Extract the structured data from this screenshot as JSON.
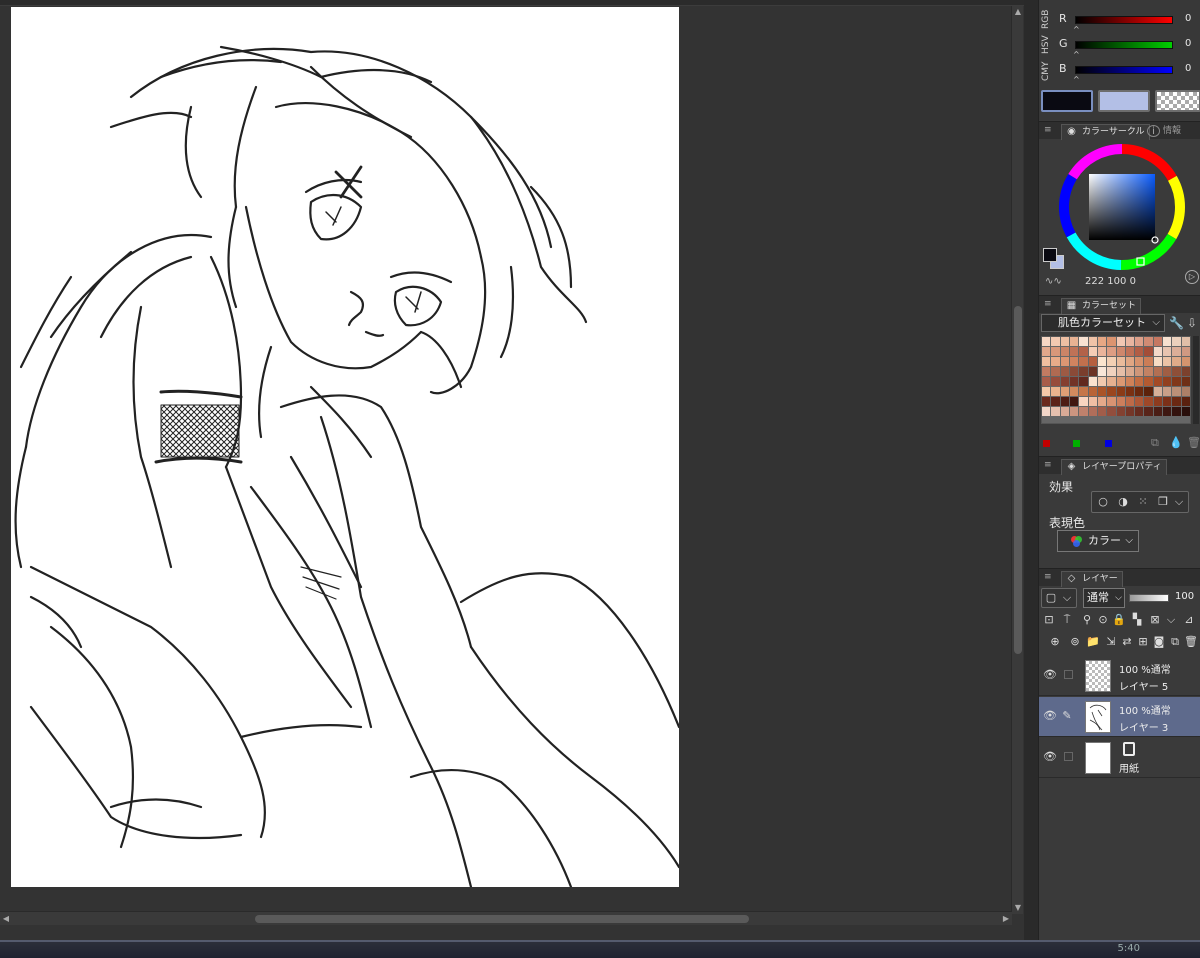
{
  "color_sliders": {
    "mode_tabs": [
      "RGB",
      "HSV",
      "CMY"
    ],
    "rows": [
      {
        "label": "R",
        "value": "0",
        "gradient": [
          "#000000",
          "#ff0000"
        ]
      },
      {
        "label": "G",
        "value": "0",
        "gradient": [
          "#000000",
          "#00d000"
        ]
      },
      {
        "label": "B",
        "value": "0",
        "gradient": [
          "#000000",
          "#0000ff"
        ]
      }
    ]
  },
  "colors": {
    "main": "#0a0a12",
    "sub": "#b3bfe6",
    "panel": "#3a3a3a",
    "selected_layer": "#5e6a8c"
  },
  "color_circle": {
    "tab": "カラーサークル",
    "tab2": "情報",
    "h_value": "222",
    "s_value": "100",
    "v_value": "0"
  },
  "color_set": {
    "tab": "カラーセット",
    "selected": "肌色カラーセット",
    "palette": [
      "#f7d7c4",
      "#f3c9b1",
      "#eebfa3",
      "#e8b293",
      "#f9e2d2",
      "#f0c3a8",
      "#e7a784",
      "#dc9470",
      "#f2c7b3",
      "#e9b5a0",
      "#dea08a",
      "#d18b74",
      "#c67862",
      "#f7e1d0",
      "#ecd1bd",
      "#e1bfa8",
      "#e2a88c",
      "#d8977a",
      "#cb8467",
      "#be7257",
      "#b26249",
      "#f5cdb5",
      "#eab49b",
      "#dd9d83",
      "#cf876c",
      "#c07157",
      "#b15d45",
      "#a34d38",
      "#f4d9c9",
      "#e8c4b0",
      "#dcae98",
      "#d09982",
      "#f1bfa0",
      "#e9ab89",
      "#dd9673",
      "#d0835f",
      "#c2704d",
      "#b55f3f",
      "#fbe5cf",
      "#f3d0b4",
      "#eabb9b",
      "#e0a683",
      "#d6916c",
      "#cb7d57",
      "#f6dcc5",
      "#ebc3a6",
      "#e0ab89",
      "#d5946e",
      "#c27b62",
      "#b06a52",
      "#9d5a44",
      "#8a4a37",
      "#7a3e2d",
      "#6b3325",
      "#f8e6d8",
      "#f0d2bf",
      "#e6bea7",
      "#dbaa8f",
      "#cf9679",
      "#c38264",
      "#b26f53",
      "#a05e44",
      "#8e4f38",
      "#7c412d",
      "#a85c4a",
      "#964c3c",
      "#843f31",
      "#733327",
      "#62291f",
      "#fae2cf",
      "#f1c9ae",
      "#e6b08f",
      "#db9872",
      "#cf8158",
      "#c26c42",
      "#b45a31",
      "#a34a26",
      "#92401f",
      "#81371a",
      "#6f2f16",
      "#f4c8a9",
      "#eab48f",
      "#de9f76",
      "#d28a5e",
      "#c57649",
      "#b86437",
      "#aa5428",
      "#9b461e",
      "#8b3b17",
      "#7b3112",
      "#6b290e",
      "#5c220b",
      "#d7b09a",
      "#c99f88",
      "#bb8f77",
      "#ac7f67",
      "#6a2a1e",
      "#5b2319",
      "#4e1d14",
      "#421710",
      "#f9d5c0",
      "#f0bfa4",
      "#e5a98a",
      "#d99372",
      "#cc7e5c",
      "#be6a48",
      "#af5837",
      "#9e4829",
      "#8d3b1f",
      "#7c3018",
      "#6b2812",
      "#5a200e",
      "#f2d6c8",
      "#e6c0ae",
      "#d9aa96",
      "#cc9580",
      "#bf816c",
      "#b06e5a",
      "#a15d4a",
      "#924e3d",
      "#834131",
      "#743628",
      "#662c20",
      "#58241a",
      "#4a1d15",
      "#3e1711",
      "#33120d",
      "#290e0a"
    ],
    "footer_colors": [
      "#c00000",
      "#00b000",
      "#0000e0"
    ]
  },
  "layer_property": {
    "tab": "レイヤープロパティ",
    "effect_label": "効果",
    "expression_label": "表現色",
    "expression_value": "カラー"
  },
  "layers_panel": {
    "tab": "レイヤー",
    "blend_mode": "通常",
    "opacity": "100",
    "layers": [
      {
        "line1": "100 %通常",
        "line2": "レイヤー 5",
        "selected": false
      },
      {
        "line1": "100 %通常",
        "line2": "レイヤー 3",
        "selected": true
      },
      {
        "line1": "",
        "line2": "用紙",
        "selected": false
      }
    ]
  },
  "taskbar": {
    "text": "5:40"
  }
}
